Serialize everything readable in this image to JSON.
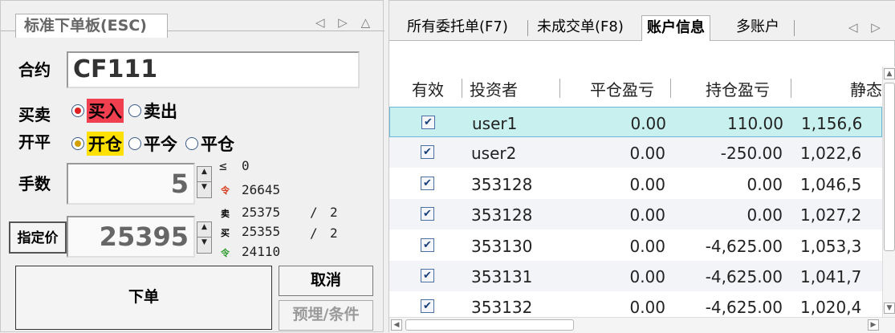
{
  "left_panel": {
    "tab_label": "标准下单板(ESC)",
    "nav_icons": "◁ ▷ △",
    "contract_label": "合约",
    "contract_value": "CF111",
    "direction_label": "买卖",
    "buy_label": "买入",
    "sell_label": "卖出",
    "open_close_label": "开平",
    "open_label": "开仓",
    "close_today_label": "平今",
    "close_label": "平仓",
    "qty_label": "手数",
    "qty_value": "5",
    "price_button_label": "指定价",
    "price_value": "25395",
    "depth": {
      "le_label": "≤",
      "le_value": "0",
      "limit_up_icon": "令",
      "limit_up": "26645",
      "ask_label": "卖",
      "ask_price": "25375",
      "ask_sep": "/",
      "ask_qty": "2",
      "bid_label": "买",
      "bid_price": "25355",
      "bid_sep": "/",
      "bid_qty": "2",
      "limit_down_icon": "令",
      "limit_down": "24110"
    },
    "order_button": "下单",
    "cancel_button": "取消",
    "preset_button": "预埋/条件"
  },
  "right_panel": {
    "tabs": [
      "所有委托单(F7)",
      "未成交单(F8)",
      "账户信息",
      "多账户"
    ],
    "active_tab": "账户信息",
    "nav_icons": "◁ ▷",
    "columns": [
      "有效",
      "投资者",
      "平仓盈亏",
      "持仓盈亏",
      "静态"
    ],
    "rows": [
      {
        "investor": "user1",
        "close_pnl": "0.00",
        "position_pnl": "110.00",
        "static": "1,156,6"
      },
      {
        "investor": "user2",
        "close_pnl": "0.00",
        "position_pnl": "-250.00",
        "static": "1,022,6"
      },
      {
        "investor": "353128",
        "close_pnl": "0.00",
        "position_pnl": "0.00",
        "static": "1,046,5"
      },
      {
        "investor": "353128",
        "close_pnl": "0.00",
        "position_pnl": "0.00",
        "static": "1,027,2"
      },
      {
        "investor": "353130",
        "close_pnl": "0.00",
        "position_pnl": "-4,625.00",
        "static": "1,053,3"
      },
      {
        "investor": "353131",
        "close_pnl": "0.00",
        "position_pnl": "-4,625.00",
        "static": "1,041,7"
      },
      {
        "investor": "353132",
        "close_pnl": "0.00",
        "position_pnl": "-4,625.00",
        "static": "1,020,4"
      }
    ],
    "checkbox_mark": "✔"
  },
  "colors": {
    "buy_highlight": "#f04050",
    "open_highlight": "#ffe000",
    "selected_row": "#c8f0ee",
    "limit_up": "#d83a1a",
    "limit_down": "#2a9a2a"
  }
}
